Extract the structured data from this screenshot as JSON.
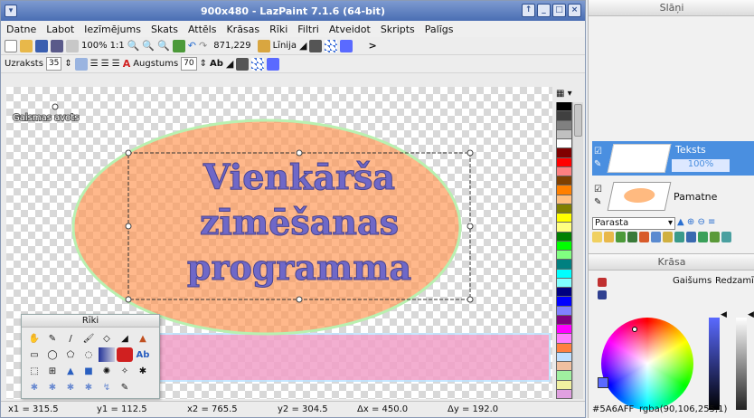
{
  "window": {
    "title": "900x480 - LazPaint 7.1.6 (64-bit)"
  },
  "menu": [
    "Datne",
    "Labot",
    "Iezīmējums",
    "Skats",
    "Attēls",
    "Krāsas",
    "Rīki",
    "Filtri",
    "Atveidot",
    "Skripts",
    "Palīgs"
  ],
  "toolbar1": {
    "zoom": "100%",
    "ratio": "1:1",
    "coords": "871,229",
    "line_label": "Līnija"
  },
  "toolbar2": {
    "text_label": "Uzraksts",
    "text_size": "35",
    "height_label": "Augstums",
    "height_value": "70",
    "ab": "Ab"
  },
  "canvas": {
    "light_label": "Gaismas avots",
    "text_lines": [
      "Vienkārša",
      "zīmēšanas",
      "programma"
    ]
  },
  "tools": {
    "title": "Rīki",
    "ab": "Ab"
  },
  "status": {
    "x1": "x1 = 315.5",
    "y1": "y1 = 112.5",
    "x2": "x2 = 765.5",
    "y2": "y2 = 304.5",
    "dx": "Δx = 450.0",
    "dy": "Δy = 192.0"
  },
  "layers": {
    "title": "Slāņi",
    "layer1_name": "Teksts",
    "layer1_opacity": "100%",
    "layer2_name": "Pamatne",
    "blend": "Parasta"
  },
  "color": {
    "title": "Krāsa",
    "brightness_label": "Gaišums",
    "visible_label": "Redzamība",
    "hex": "#5A6AFF",
    "rgba": "rgba(90,106,255,1)"
  },
  "palette": [
    "#000000",
    "#404040",
    "#808080",
    "#c0c0c0",
    "#ffffff",
    "#800000",
    "#ff0000",
    "#ff8080",
    "#804000",
    "#ff8000",
    "#ffc080",
    "#808000",
    "#ffff00",
    "#ffff80",
    "#008000",
    "#00ff00",
    "#80ff80",
    "#008080",
    "#00ffff",
    "#80ffff",
    "#000080",
    "#0000ff",
    "#8080ff",
    "#800080",
    "#ff00ff",
    "#ff80ff",
    "#ff8040",
    "#c0e0ff",
    "#f0c0a0",
    "#a0f0a0",
    "#f0f0a0",
    "#e0a0e0"
  ]
}
